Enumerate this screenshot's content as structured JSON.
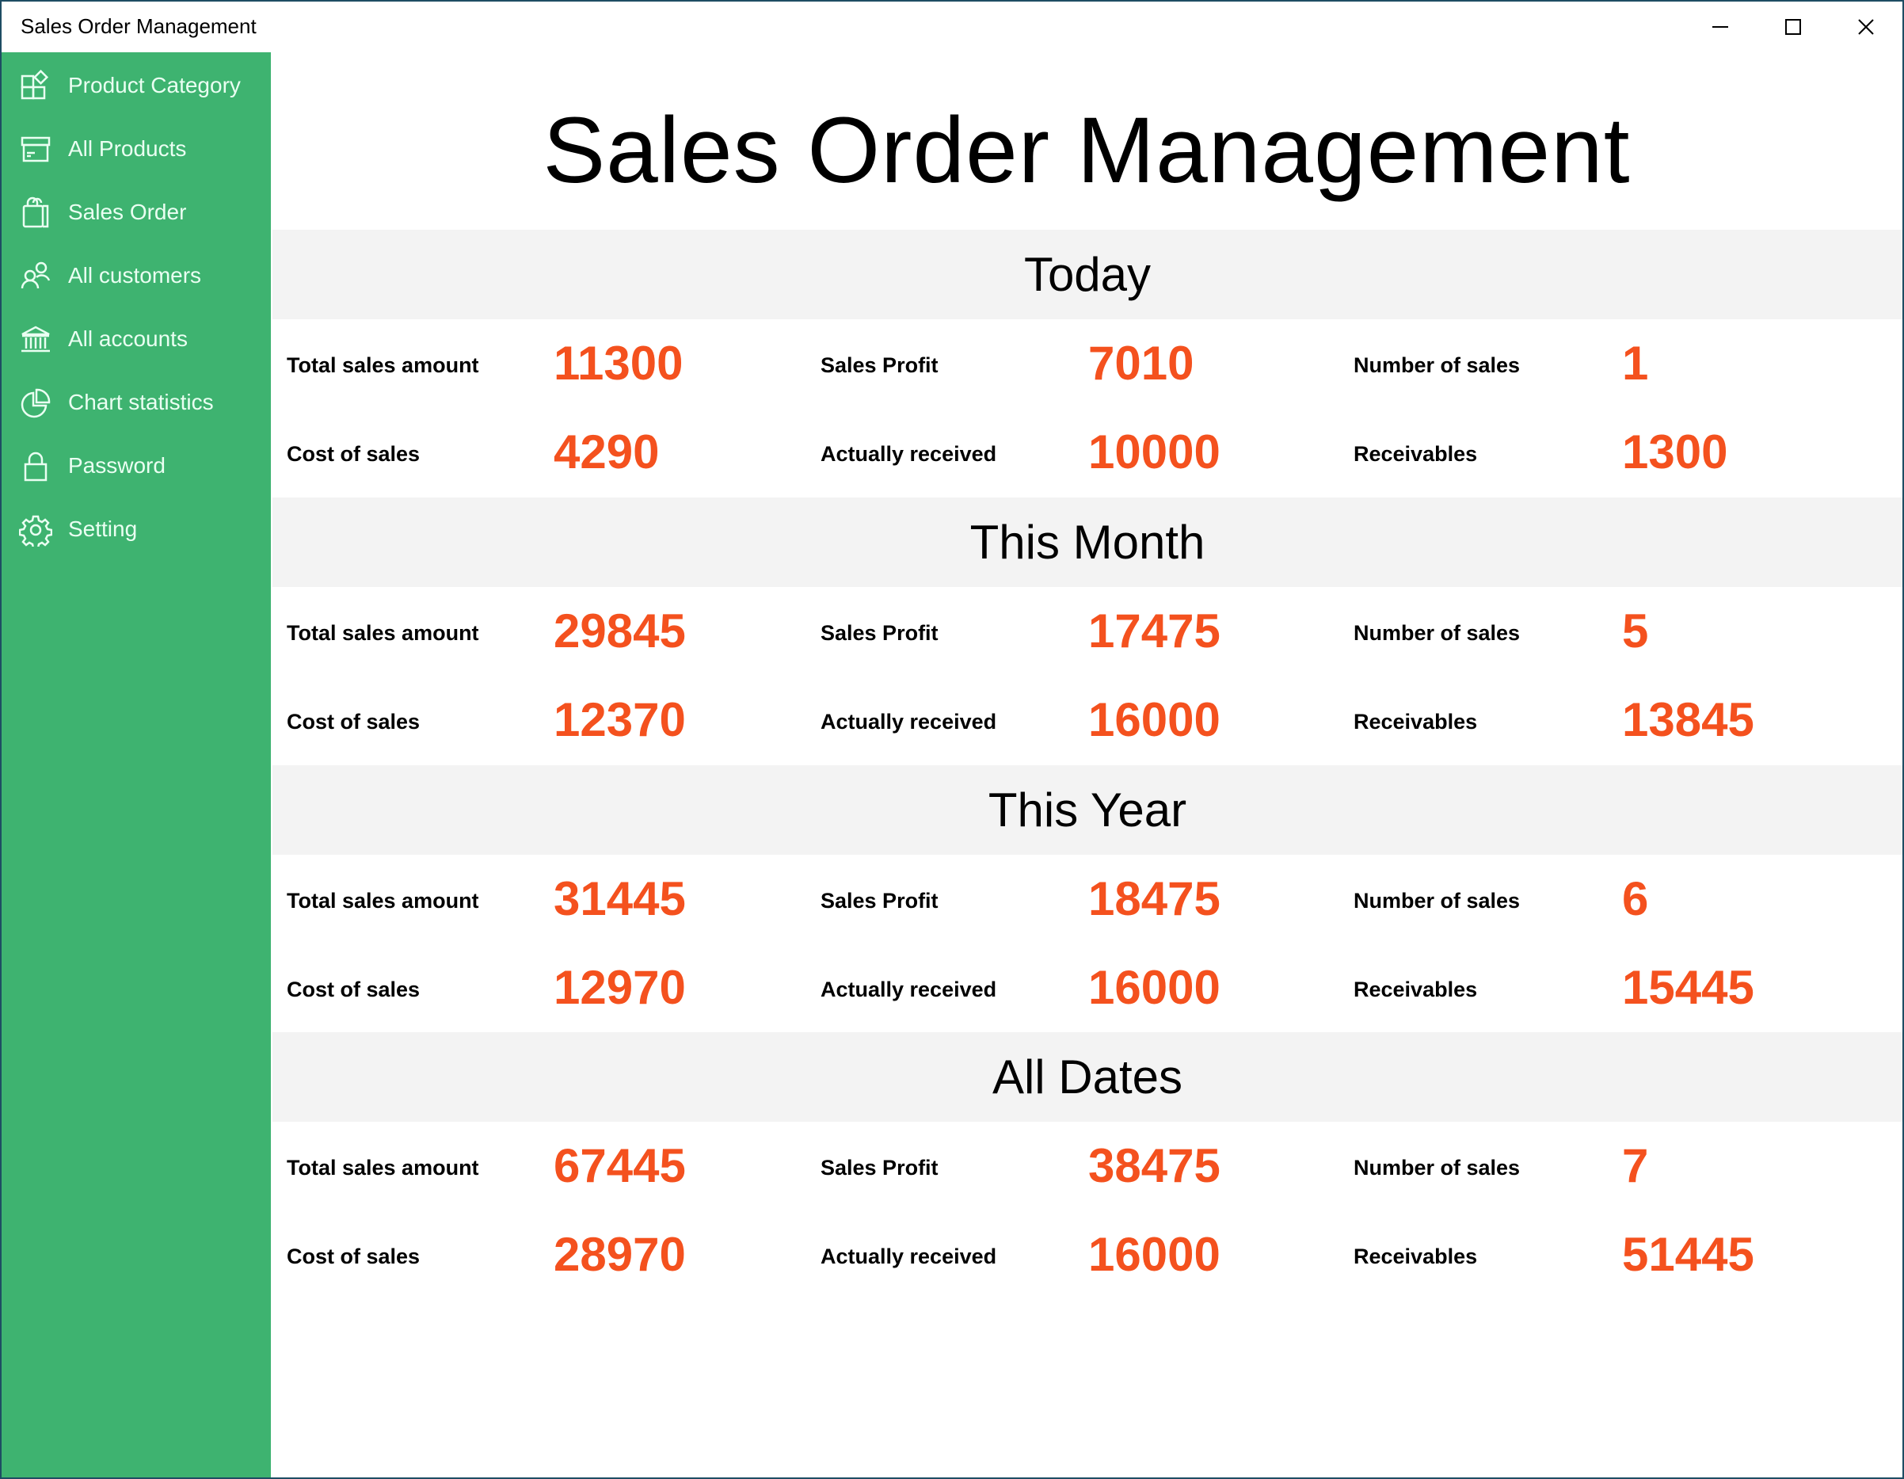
{
  "window": {
    "title": "Sales Order Management",
    "controls": {
      "minimize": "minimize",
      "maximize": "maximize",
      "close": "close"
    }
  },
  "sidebar": {
    "background": "#3eb370",
    "items": [
      {
        "label": "Product Category",
        "icon": "category-icon"
      },
      {
        "label": "All Products",
        "icon": "archive-box-icon"
      },
      {
        "label": "Sales Order",
        "icon": "shopping-bag-icon"
      },
      {
        "label": "All customers",
        "icon": "people-icon"
      },
      {
        "label": "All accounts",
        "icon": "bank-icon"
      },
      {
        "label": "Chart statistics",
        "icon": "pie-chart-icon"
      },
      {
        "label": "Password",
        "icon": "lock-icon"
      },
      {
        "label": "Setting",
        "icon": "gear-icon"
      }
    ]
  },
  "main": {
    "title": "Sales Order Management",
    "value_color": "#f4511e",
    "labels": {
      "total_sales_amount": "Total sales amount",
      "sales_profit": "Sales Profit",
      "number_of_sales": "Number of sales",
      "cost_of_sales": "Cost of sales",
      "actually_received": "Actually received",
      "receivables": "Receivables"
    },
    "sections": [
      {
        "title": "Today",
        "total_sales_amount": "11300",
        "sales_profit": "7010",
        "number_of_sales": "1",
        "cost_of_sales": "4290",
        "actually_received": "10000",
        "receivables": "1300"
      },
      {
        "title": "This Month",
        "total_sales_amount": "29845",
        "sales_profit": "17475",
        "number_of_sales": "5",
        "cost_of_sales": "12370",
        "actually_received": "16000",
        "receivables": "13845"
      },
      {
        "title": "This Year",
        "total_sales_amount": "31445",
        "sales_profit": "18475",
        "number_of_sales": "6",
        "cost_of_sales": "12970",
        "actually_received": "16000",
        "receivables": "15445"
      },
      {
        "title": "All Dates",
        "total_sales_amount": "67445",
        "sales_profit": "38475",
        "number_of_sales": "7",
        "cost_of_sales": "28970",
        "actually_received": "16000",
        "receivables": "51445"
      }
    ]
  }
}
